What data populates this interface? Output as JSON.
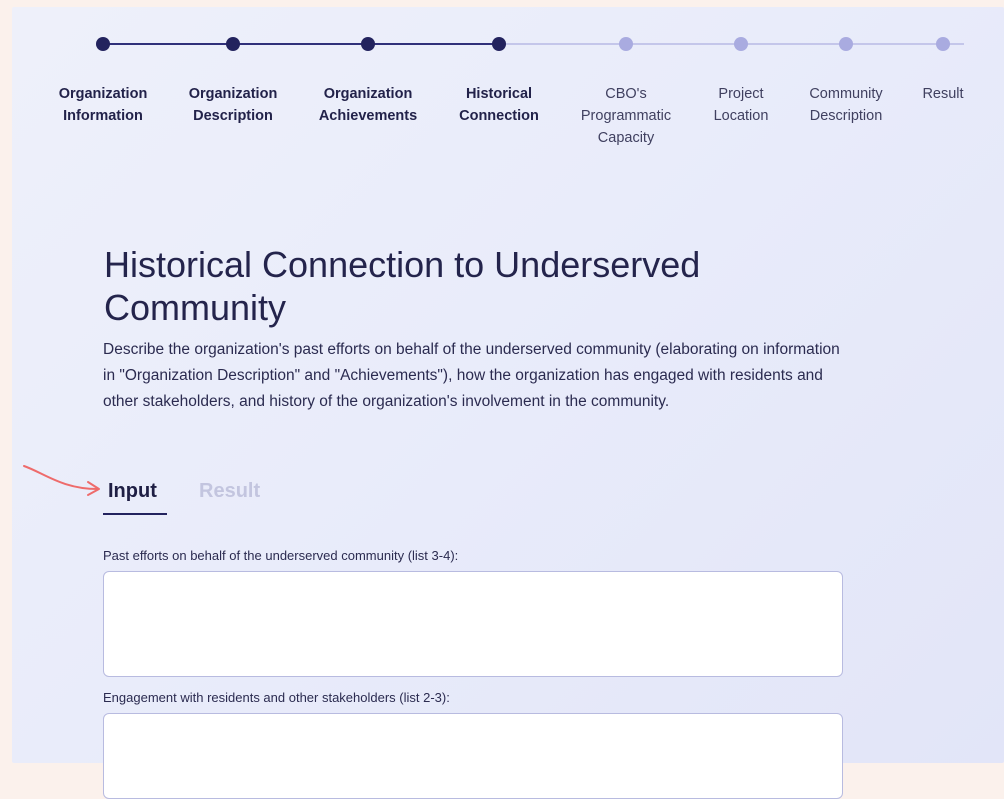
{
  "stepper": {
    "steps": [
      {
        "label": "Organization\nInformation",
        "state": "done"
      },
      {
        "label": "Organization\nDescription",
        "state": "done"
      },
      {
        "label": "Organization\nAchievements",
        "state": "done"
      },
      {
        "label": "Historical\nConnection",
        "state": "done"
      },
      {
        "label": "CBO's\nProgrammatic\nCapacity",
        "state": "todo"
      },
      {
        "label": "Project\nLocation",
        "state": "todo"
      },
      {
        "label": "Community\nDescription",
        "state": "todo"
      },
      {
        "label": "Result",
        "state": "todo"
      }
    ],
    "colors": {
      "done": "#23235e",
      "todo": "#a9abe0"
    }
  },
  "page": {
    "title": "Historical Connection to Underserved Community",
    "description": "Describe the organization's past efforts on behalf of the underserved community (elaborating on information in \"Organization Description\" and \"Achievements\"), how the organization has engaged with residents and other stakeholders, and history of the organization's involvement in the community."
  },
  "tabs": {
    "input_label": "Input",
    "result_label": "Result",
    "active": "Input"
  },
  "form": {
    "fields": [
      {
        "label": "Past efforts on behalf of the underserved community (list 3-4):",
        "value": ""
      },
      {
        "label": "Engagement with residents and other stakeholders (list 2-3):",
        "value": ""
      }
    ]
  },
  "annotation": {
    "arrow_color": "#ee6b6b"
  }
}
